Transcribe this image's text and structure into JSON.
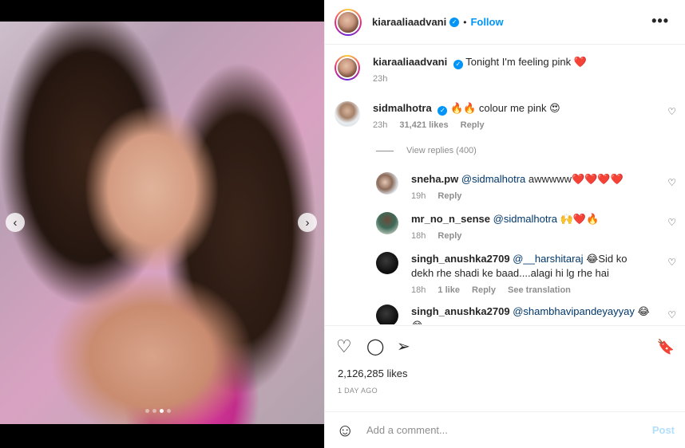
{
  "post": {
    "username": "kiaraaliaadvani",
    "follow_label": "Follow",
    "separator": "•",
    "more_label": "•••",
    "caption": "Tonight I'm feeling pink ❤️",
    "caption_time": "23h",
    "likes_text": "2,126,285 likes",
    "date_text": "1 DAY AGO"
  },
  "media": {
    "prev_arrow": "‹",
    "next_arrow": "›",
    "slide_count": 4,
    "active_slide": 4
  },
  "comments": [
    {
      "username": "sidmalhotra",
      "text": "🔥🔥 colour me pink 😍",
      "time": "23h",
      "likes": "31,421 likes",
      "reply_label": "Reply"
    }
  ],
  "view_replies": "View replies (400)",
  "replies": [
    {
      "username": "sneha.pw",
      "mention": "@sidmalhotra",
      "text": " awwwww❤️❤️❤️❤️",
      "time": "19h",
      "likes": "",
      "reply_label": "Reply",
      "translation_label": ""
    },
    {
      "username": "mr_no_n_sense",
      "mention": "@sidmalhotra",
      "text": " 🙌❤️🔥",
      "time": "18h",
      "likes": "",
      "reply_label": "Reply",
      "translation_label": ""
    },
    {
      "username": "singh_anushka2709",
      "mention": "@__harshitaraj",
      "text": " 😂Sid ko dekh rhe shadi ke baad....alagi hi lg rhe hai",
      "time": "18h",
      "likes": "1 like",
      "reply_label": "Reply",
      "translation_label": "See translation"
    },
    {
      "username": "singh_anushka2709",
      "mention": "@shambhavipandeyayyay",
      "text": " 😂😂",
      "time": "",
      "likes": "",
      "reply_label": "",
      "translation_label": ""
    }
  ],
  "icons": {
    "heart": "♡",
    "comment": "◯",
    "share": "➢",
    "bookmark": "🔖",
    "emoji": "☺",
    "small_heart": "♡",
    "verified": "✓"
  },
  "add_comment": {
    "placeholder": "Add a comment...",
    "post_label": "Post"
  },
  "colors": {
    "accent": "#0095f6",
    "post_disabled": "#b2dffc",
    "muted": "#8e8e8e"
  }
}
